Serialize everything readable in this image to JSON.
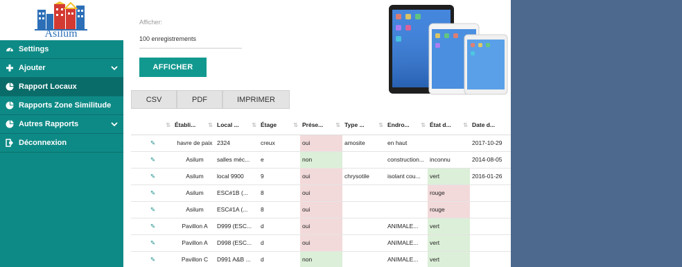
{
  "app": {
    "logo_text": "Asilum"
  },
  "sidebar": {
    "items": [
      {
        "label": "Settings",
        "icon": "dashboard-icon",
        "chevron": false,
        "active": false
      },
      {
        "label": "Ajouter",
        "icon": "plus-icon",
        "chevron": true,
        "active": false
      },
      {
        "label": "Rapport Locaux",
        "icon": "pie-chart-icon",
        "chevron": false,
        "active": true
      },
      {
        "label": "Rapports Zone Similitude",
        "icon": "pie-chart-icon",
        "chevron": false,
        "active": false
      },
      {
        "label": "Autres Rapports",
        "icon": "pie-chart-icon",
        "chevron": true,
        "active": false
      },
      {
        "label": "Déconnexion",
        "icon": "sign-out-icon",
        "chevron": false,
        "active": false
      }
    ]
  },
  "controls": {
    "afficher_label": "Afficher:",
    "records_value": "100 enregistrements",
    "afficher_button": "AFFICHER"
  },
  "export": {
    "csv": "CSV",
    "pdf": "PDF",
    "print": "IMPRIMER"
  },
  "table": {
    "headers": [
      "",
      "Établi...",
      "Local ...",
      "Étage",
      "Prése...",
      "Type ...",
      "Endro...",
      "État d...",
      "Date d..."
    ],
    "rows": [
      {
        "etab": "havre de paix",
        "local": "2324",
        "etage": "creux",
        "presence": "oui",
        "type": "amosite",
        "endroit": "en haut",
        "etat": "",
        "date": "2017-10-29"
      },
      {
        "etab": "Asilum",
        "local": "salles méc...",
        "etage": "e",
        "presence": "non",
        "type": "",
        "endroit": "construction...",
        "etat": "inconnu",
        "date": "2014-08-05"
      },
      {
        "etab": "Asilum",
        "local": "local 9900",
        "etage": "9",
        "presence": "oui",
        "type": "chrysotile",
        "endroit": "isolant cou...",
        "etat": "vert",
        "date": "2016-01-26"
      },
      {
        "etab": "Asilum",
        "local": "ESC#1B (...",
        "etage": "8",
        "presence": "oui",
        "type": "",
        "endroit": "",
        "etat": "rouge",
        "date": ""
      },
      {
        "etab": "Asilum",
        "local": "ESC#1A (...",
        "etage": "8",
        "presence": "oui",
        "type": "",
        "endroit": "",
        "etat": "rouge",
        "date": ""
      },
      {
        "etab": "Pavillon A",
        "local": "D999 (ESC...",
        "etage": "d",
        "presence": "oui",
        "type": "",
        "endroit": "ANIMALE...",
        "etat": "vert",
        "date": ""
      },
      {
        "etab": "Pavillon A",
        "local": "D998 (ESC...",
        "etage": "d",
        "presence": "oui",
        "type": "",
        "endroit": "ANIMALE...",
        "etat": "vert",
        "date": ""
      },
      {
        "etab": "Pavillon C",
        "local": "D991 A&B ...",
        "etage": "d",
        "presence": "non",
        "type": "",
        "endroit": "ANIMALE...",
        "etat": "vert",
        "date": ""
      }
    ]
  },
  "colors": {
    "sidebar_teal": "#0e8a86",
    "button_teal": "#12998f",
    "right_panel": "#4d6a8e",
    "cell_red": "#f3dada",
    "cell_green": "#dcefd8"
  }
}
